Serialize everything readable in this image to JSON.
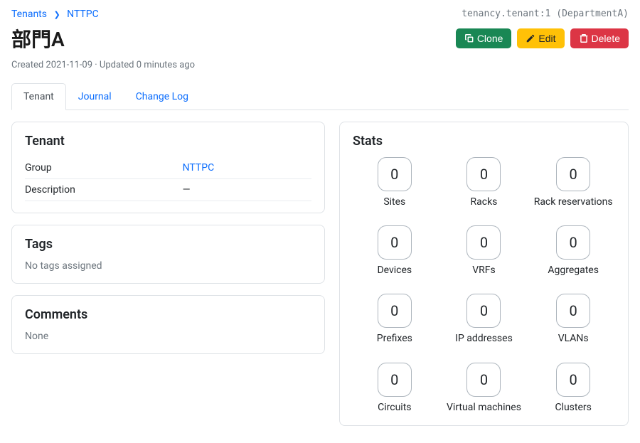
{
  "breadcrumb": {
    "root": "Tenants",
    "current": "NTTPC"
  },
  "object_ref": "tenancy.tenant:1 (DepartmentA)",
  "page_title": "部門A",
  "meta": "Created 2021-11-09 · Updated 0 minutes ago",
  "actions": {
    "clone": "Clone",
    "edit": "Edit",
    "delete": "Delete"
  },
  "tabs": {
    "tenant": "Tenant",
    "journal": "Journal",
    "changelog": "Change Log"
  },
  "tenant_card": {
    "title": "Tenant",
    "group_label": "Group",
    "group_value": "NTTPC",
    "description_label": "Description",
    "description_value": "—"
  },
  "tags_card": {
    "title": "Tags",
    "empty": "No tags assigned"
  },
  "comments_card": {
    "title": "Comments",
    "empty": "None"
  },
  "stats_card": {
    "title": "Stats",
    "items": [
      {
        "count": "0",
        "label": "Sites"
      },
      {
        "count": "0",
        "label": "Racks"
      },
      {
        "count": "0",
        "label": "Rack reservations"
      },
      {
        "count": "0",
        "label": "Devices"
      },
      {
        "count": "0",
        "label": "VRFs"
      },
      {
        "count": "0",
        "label": "Aggregates"
      },
      {
        "count": "0",
        "label": "Prefixes"
      },
      {
        "count": "0",
        "label": "IP addresses"
      },
      {
        "count": "0",
        "label": "VLANs"
      },
      {
        "count": "0",
        "label": "Circuits"
      },
      {
        "count": "0",
        "label": "Virtual machines"
      },
      {
        "count": "0",
        "label": "Clusters"
      }
    ]
  }
}
